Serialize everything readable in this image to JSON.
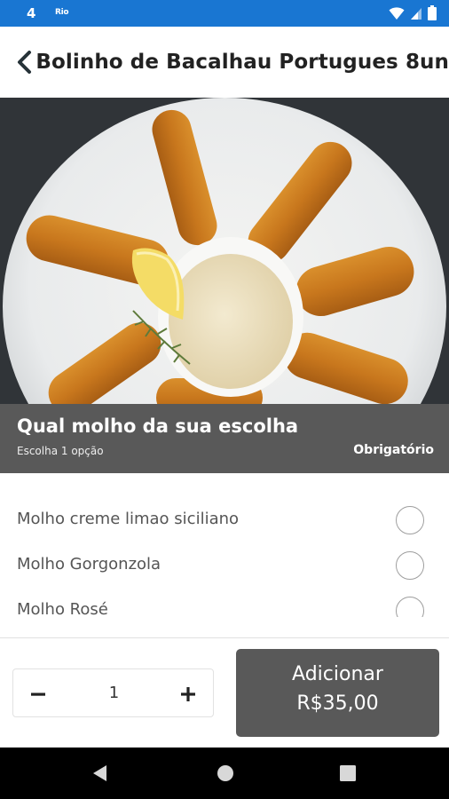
{
  "status_bar": {
    "time": "4",
    "app_badge": "Rio",
    "icons": [
      "wifi-icon",
      "signal-icon",
      "battery-icon"
    ]
  },
  "app_bar": {
    "back_icon": "chevron-left-icon",
    "title": "Bolinho de Bacalhau Portugues 8un"
  },
  "question": {
    "title": "Qual molho da sua escolha",
    "subtitle": "Escolha 1 opção",
    "required_label": "Obrigatório"
  },
  "options": [
    {
      "label": "Molho creme limao siciliano",
      "selected": false
    },
    {
      "label": "Molho Gorgonzola",
      "selected": false
    },
    {
      "label": "Molho Rosé",
      "selected": false
    }
  ],
  "quantity": {
    "value": "1",
    "minus_icon": "minus-icon",
    "plus_icon": "plus-icon"
  },
  "add_button": {
    "label": "Adicionar",
    "price": "R$35,00"
  },
  "colors": {
    "status_bar": "#1976d2",
    "header_gray": "#595959",
    "button_gray": "#595959"
  },
  "nav_bar": {
    "icons": [
      "nav-back-icon",
      "nav-home-icon",
      "nav-recents-icon"
    ]
  }
}
